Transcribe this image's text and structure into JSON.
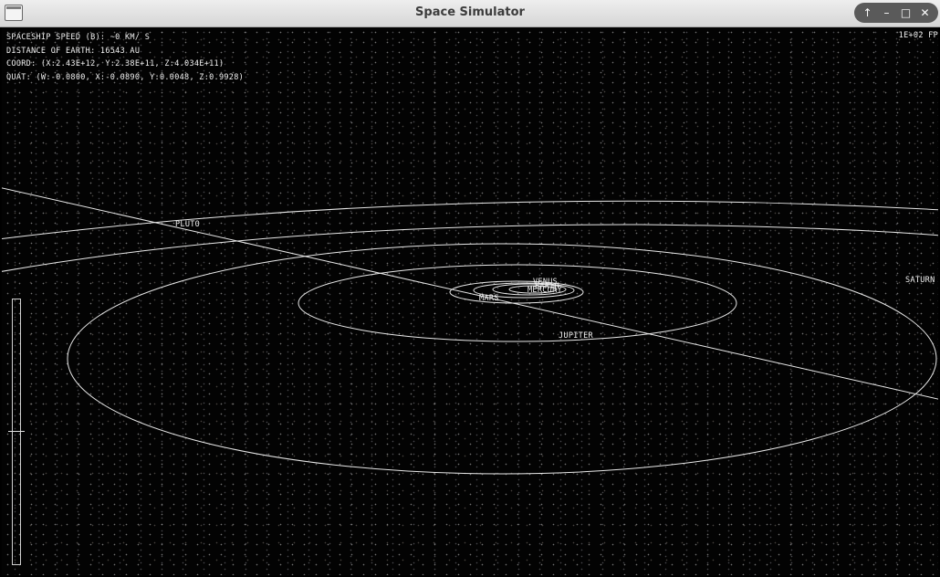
{
  "window": {
    "title": "Space Simulator",
    "controls": [
      "↑",
      "–",
      "□",
      "✕"
    ]
  },
  "hud": {
    "speed": "SPACESHIP SPEED (B): ~0 KM/ S",
    "distance": "DISTANCE OF EARTH: 16543 AU",
    "coord": "COORD: (X:2.43E+12, Y:2.38E+11, Z:4.034E+11)",
    "quat": "QUAT: (W:-0.0800, X:-0.0890, Y:0.0048, Z:0.9928)",
    "fps": "1E+02 FP"
  },
  "planets": {
    "pluto": "PLUTO",
    "saturn": "SATURN",
    "jupiter": "JUPITER",
    "mars": "MARS",
    "earth": "EARTH",
    "venus": "VENUS",
    "mercury": "MERCURY"
  },
  "colors": {
    "background": "#000000",
    "orbit": "#e8e8e8",
    "text": "#f2f2f2",
    "titlebar": "#e4e4e4"
  }
}
